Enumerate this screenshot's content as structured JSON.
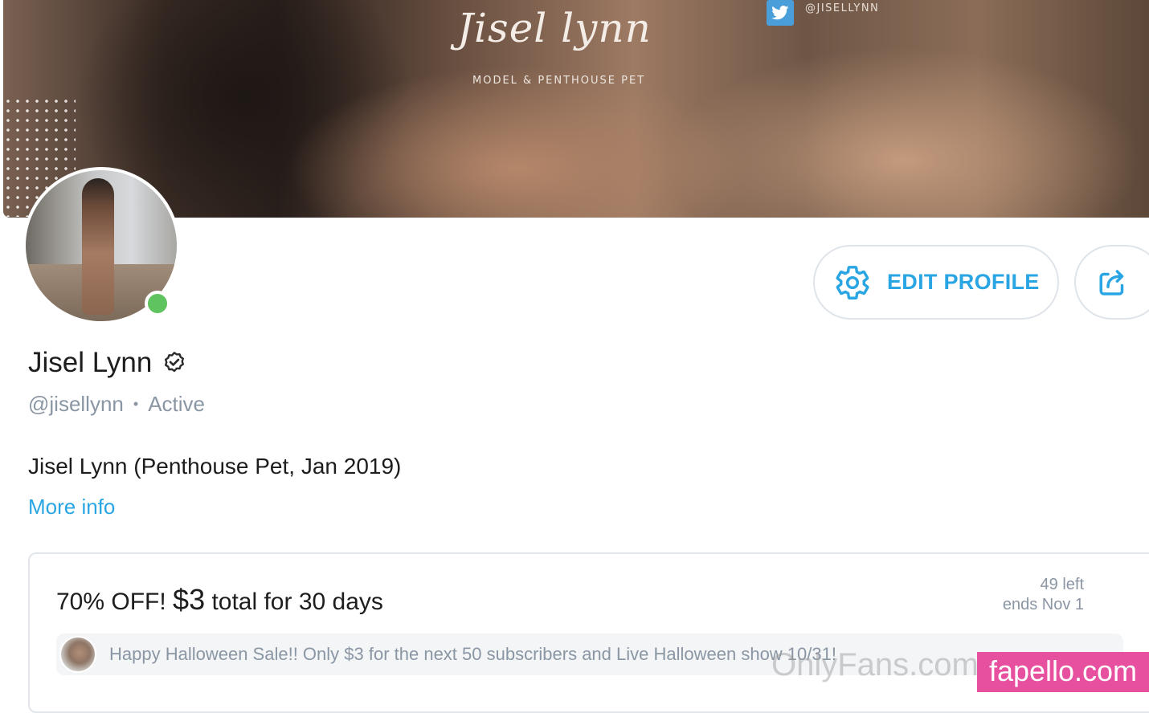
{
  "banner": {
    "title": "Jisel lynn",
    "subtitle": "MODEL & PENTHOUSE PET",
    "twitter_handle": "@JISELLYNN",
    "twitter_icon": "twitter-bird-icon"
  },
  "profile": {
    "name": "Jisel Lynn",
    "verified_icon": "verified-badge-icon",
    "handle": "@jisellynn",
    "separator": "•",
    "status": "Active",
    "status_color": "#5fc35f",
    "bio": "Jisel Lynn (Penthouse Pet, Jan 2019)",
    "more_info": "More info"
  },
  "actions": {
    "edit_profile_label": "EDIT PROFILE",
    "edit_icon": "gear-icon",
    "share_icon": "share-icon",
    "accent_color": "#2aa5e4"
  },
  "promo": {
    "title_prefix": "70% OFF!",
    "price": "$3",
    "title_suffix": "total for 30 days",
    "remaining": "49 left",
    "ends": "ends Nov 1",
    "message": "Happy Halloween Sale!! Only $3 for the next 50 subscribers and Live Halloween show 10/31!"
  },
  "watermarks": {
    "onlyfans": "OnlyFans.com",
    "fapello": "fapello.com",
    "fapello_color": "#e74f9f"
  }
}
